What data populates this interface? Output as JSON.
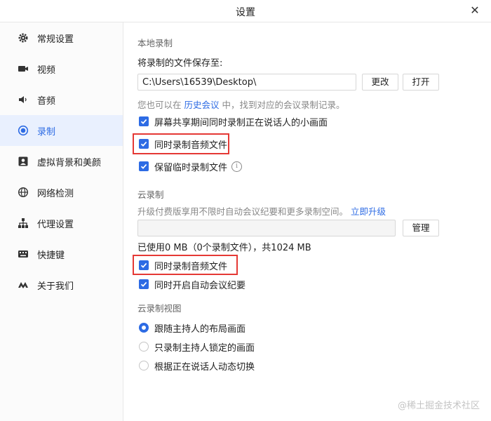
{
  "window": {
    "title": "设置",
    "close_glyph": "✕"
  },
  "sidebar": {
    "items": [
      {
        "label": "常规设置",
        "icon": "gear-icon"
      },
      {
        "label": "视频",
        "icon": "video-camera-icon"
      },
      {
        "label": "音频",
        "icon": "speaker-icon"
      },
      {
        "label": "录制",
        "icon": "record-icon",
        "active": true
      },
      {
        "label": "虚拟背景和美颜",
        "icon": "portrait-icon"
      },
      {
        "label": "网络检测",
        "icon": "globe-icon"
      },
      {
        "label": "代理设置",
        "icon": "network-icon"
      },
      {
        "label": "快捷键",
        "icon": "keyboard-icon"
      },
      {
        "label": "关于我们",
        "icon": "logo-icon"
      }
    ]
  },
  "local_recording": {
    "section_title": "本地录制",
    "save_to_label": "将录制的文件保存至:",
    "path_value": "C:\\Users\\16539\\Desktop\\",
    "change_button": "更改",
    "open_button": "打开",
    "hint_prefix": "您也可以在",
    "hint_link": "历史会议",
    "hint_suffix": "中，找到对应的会议录制记录。",
    "options": [
      {
        "label": "屏幕共享期间同时录制正在说话人的小画面",
        "checked": true
      },
      {
        "label": "同时录制音频文件",
        "checked": true
      },
      {
        "label": "保留临时录制文件",
        "checked": true
      }
    ]
  },
  "cloud_recording": {
    "section_title": "云录制",
    "upgrade_text": "升级付费版享用不限时自动会议纪要和更多录制空间。",
    "upgrade_link": "立即升级",
    "manage_button": "管理",
    "usage_text": "已使用0 MB（0个录制文件），共1024 MB",
    "options": [
      {
        "label": "同时录制音频文件",
        "checked": true
      },
      {
        "label": "同时开启自动会议纪要",
        "checked": true
      }
    ]
  },
  "cloud_view": {
    "section_title": "云录制视图",
    "options": [
      {
        "label": "跟随主持人的布局画面",
        "selected": true
      },
      {
        "label": "只录制主持人锁定的画面",
        "selected": false
      },
      {
        "label": "根据正在说话人动态切换",
        "selected": false
      }
    ]
  },
  "watermark": "@稀土掘金技术社区",
  "colors": {
    "accent": "#2d6be4",
    "highlight": "#e53935"
  }
}
